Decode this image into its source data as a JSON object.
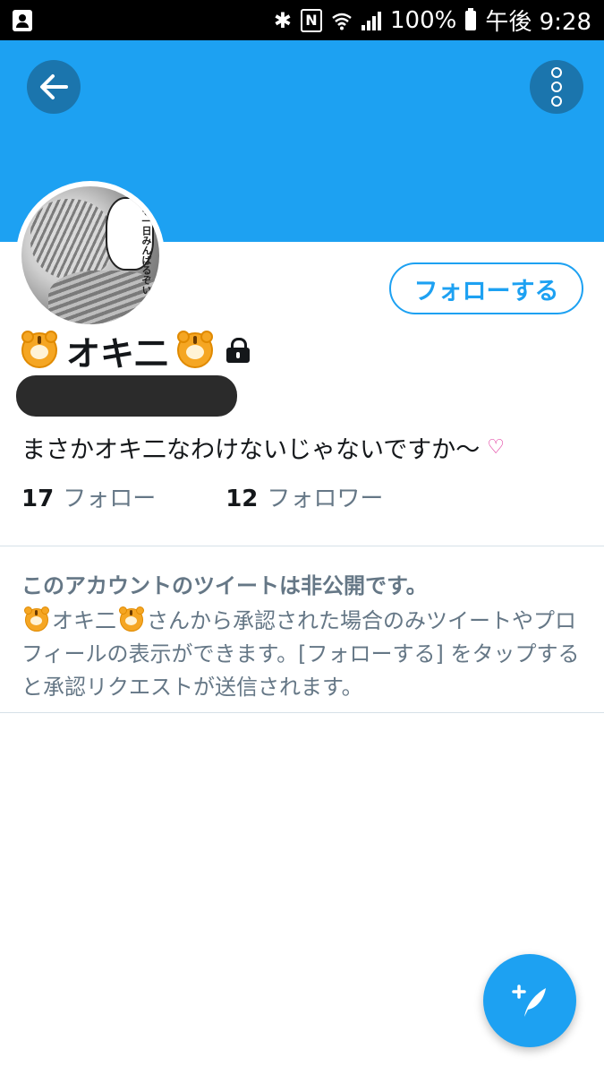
{
  "status_bar": {
    "battery": "100%",
    "time": "午後 9:28"
  },
  "profile": {
    "follow_button": "フォローする",
    "display_name": "オキ二",
    "avatar_bubble_text": "も一日みんばるぞい",
    "bio": "まさかオキ二なわけないじゃないですか〜",
    "following_count": "17",
    "following_label": "フォロー",
    "followers_count": "12",
    "followers_label": "フォロワー"
  },
  "protected_notice": {
    "title": "このアカウントのツイートは非公開です。",
    "name": "オキ二",
    "body": "さんから承認された場合のみツイートやプロフィールの表示ができます。[フォローする] をタップすると承認リクエストが送信されます。"
  },
  "colors": {
    "accent": "#1da1f2",
    "banner": "#1da1f2",
    "muted_text": "#657786"
  },
  "icons": {
    "back": "arrow-left-icon",
    "more": "more-vertical-icon",
    "lock": "lock-icon",
    "compose": "compose-tweet-icon"
  }
}
